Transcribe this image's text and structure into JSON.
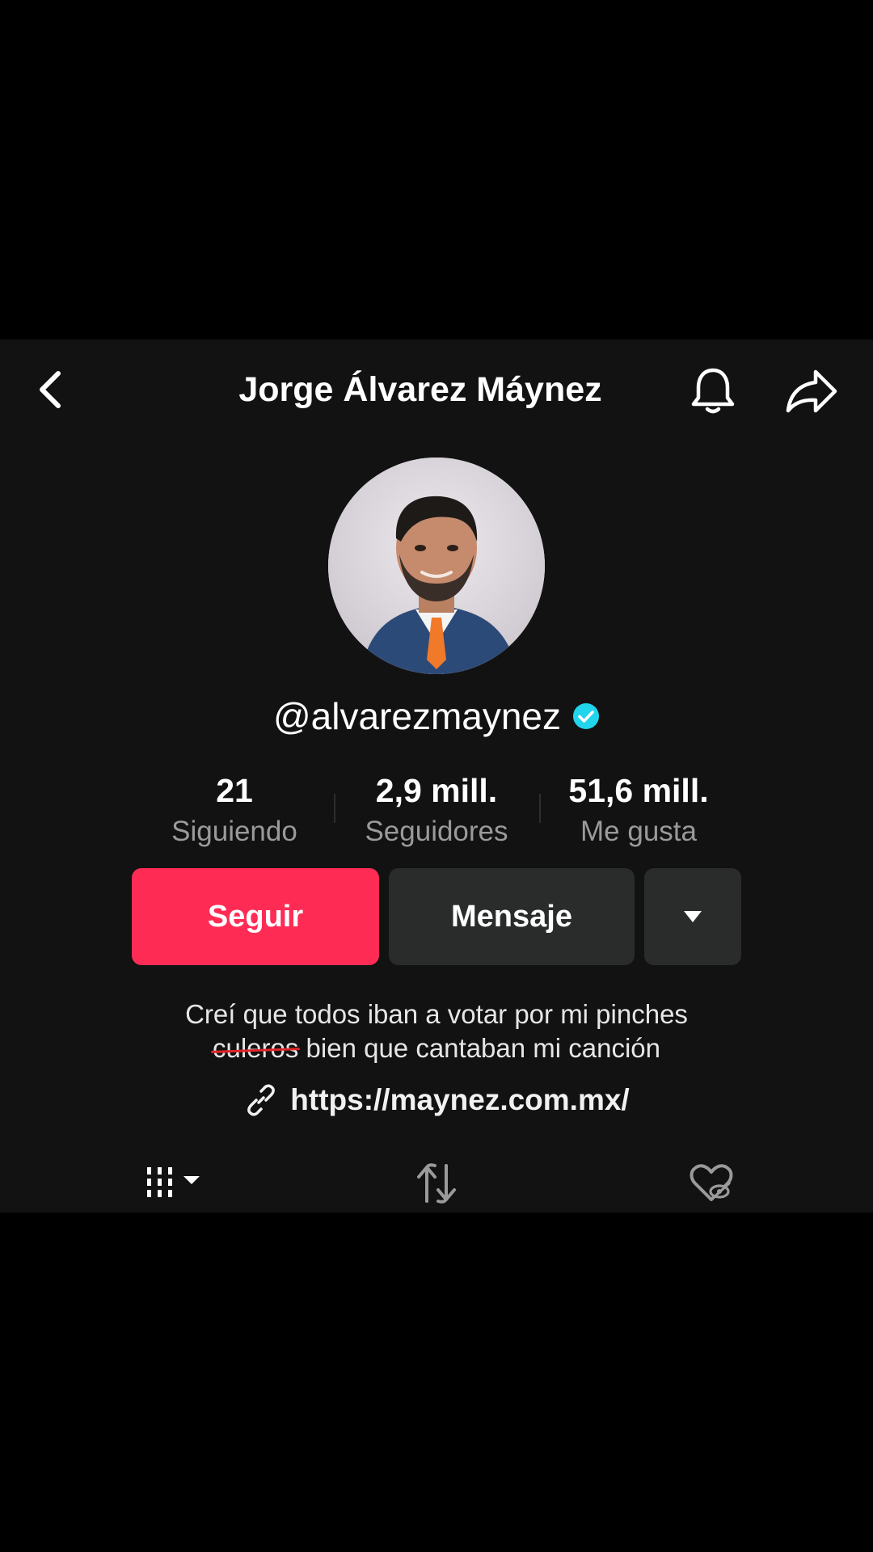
{
  "header": {
    "title": "Jorge Álvarez Máynez",
    "back_icon": "chevron-left-icon",
    "bell_icon": "bell-icon",
    "share_icon": "share-arrow-icon"
  },
  "profile": {
    "handle": "@alvarezmaynez",
    "verified": true,
    "verified_color": "#20d5ec"
  },
  "stats": [
    {
      "value": "21",
      "label": "Siguiendo"
    },
    {
      "value": "2,9 mill.",
      "label": "Seguidores"
    },
    {
      "value": "51,6 mill.",
      "label": "Me gusta"
    }
  ],
  "actions": {
    "follow_label": "Seguir",
    "message_label": "Mensaje",
    "more_icon": "caret-down-icon",
    "follow_color": "#fe2c55"
  },
  "bio": {
    "line1": "Creí que todos iban a votar por mi pinches",
    "struck_word": "culeros",
    "line2_rest": " bien que cantaban mi canción",
    "annotation_color": "#e0262a"
  },
  "link": {
    "url": "https://maynez.com.mx/",
    "icon": "link-icon"
  },
  "tabs": {
    "videos_icon": "grid-icon",
    "reposts_icon": "repost-icon",
    "liked_icon": "hidden-heart-icon"
  }
}
